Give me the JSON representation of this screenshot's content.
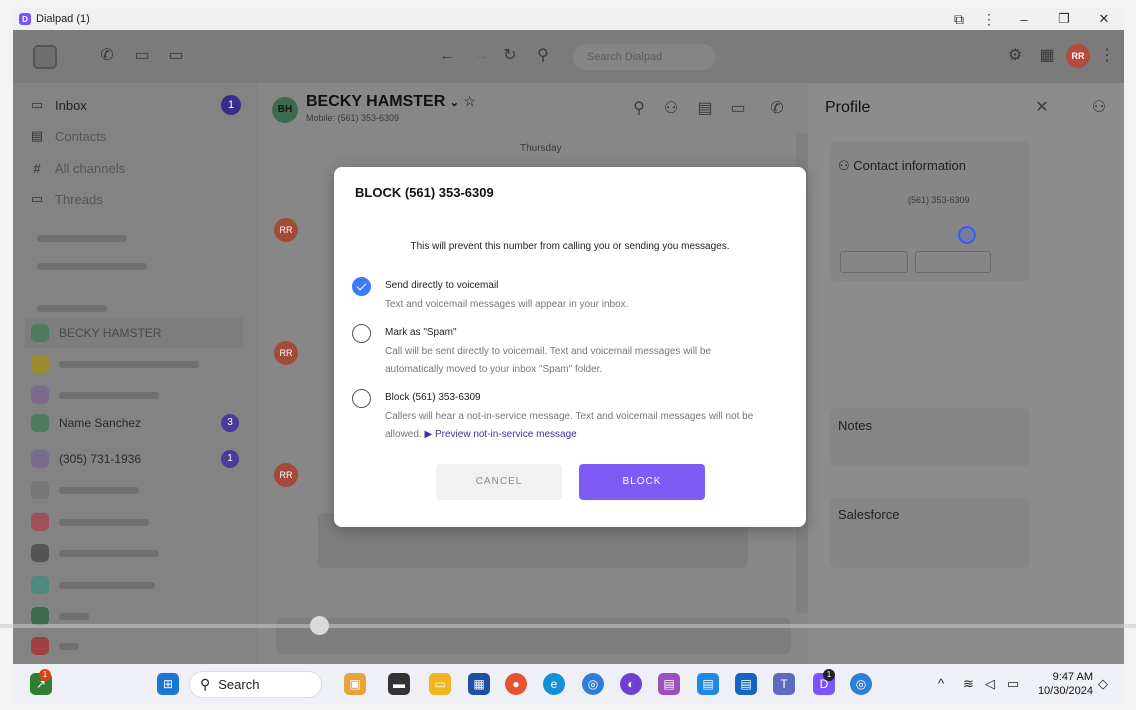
{
  "window": {
    "title": "Dialpad (1)"
  },
  "topbar": {
    "search_placeholder": "Search Dialpad",
    "avatar": "RR"
  },
  "sidebar": {
    "items": [
      {
        "label": "Inbox",
        "badge": "1"
      },
      {
        "label": "Contacts"
      },
      {
        "label": "All channels"
      },
      {
        "label": "Threads"
      }
    ],
    "contacts": [
      {
        "label": "BECKY HAMSTER",
        "badge": ""
      },
      {
        "label": "Name Sanchez",
        "badge": "3"
      },
      {
        "label": "(305) 731-1936",
        "badge": "1"
      }
    ]
  },
  "conversation": {
    "avatar": "BH",
    "name": "BECKY HAMSTER",
    "subtitle": "Mobile: (561) 353-6309",
    "date_label": "Thursday",
    "message_avatars": [
      "RR",
      "RR",
      "RR"
    ]
  },
  "profile": {
    "title": "Profile",
    "contact_info": "Contact information",
    "mobile": "(561) 353-6309",
    "notes": "Notes",
    "salesforce": "Salesforce"
  },
  "modal": {
    "title": "BLOCK (561) 353-6309",
    "description": "This will prevent this number from calling you or sending you messages.",
    "options": [
      {
        "label": "Send directly to voicemail",
        "desc": "Text and voicemail messages will appear in your inbox.",
        "checked": true
      },
      {
        "label": "Mark as \"Spam\"",
        "desc": "Call will be sent directly to voicemail. Text and voicemail messages will be automatically moved to your inbox \"Spam\" folder.",
        "checked": false
      },
      {
        "label": "Block (561) 353-6309",
        "desc": "Callers will hear a not-in-service message. Text and voicemail messages will not be allowed.",
        "link": "Preview not-in-service message",
        "checked": false
      }
    ],
    "cancel_label": "CANCEL",
    "block_label": "BLOCK"
  },
  "taskbar": {
    "search_label": "Search",
    "time": "9:47 AM",
    "date": "10/30/2024"
  }
}
